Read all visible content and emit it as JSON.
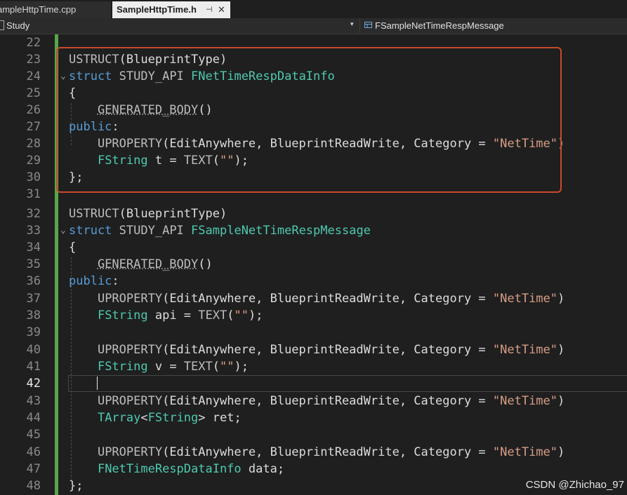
{
  "tabs": {
    "inactive_label": "ampleHttpTime.cpp",
    "active_label": "SampleHttpTime.h",
    "pin_glyph": "⊣",
    "close_glyph": "✕"
  },
  "navbar": {
    "scope_label": "Study",
    "member_label": "FSampleNetTimeRespMessage",
    "dropdown_glyph": "▾"
  },
  "editor": {
    "current_line": 42,
    "line_numbers": [
      "22",
      "23",
      "24",
      "25",
      "26",
      "27",
      "28",
      "29",
      "30",
      "31",
      "32",
      "33",
      "34",
      "35",
      "36",
      "37",
      "38",
      "39",
      "40",
      "41",
      "42",
      "43",
      "44",
      "45",
      "46",
      "47",
      "48"
    ],
    "fold_glyph": "⌄",
    "tokens": {
      "ustruct": "USTRUCT",
      "blueprint_type_args": "(BlueprintType)",
      "struct_kw": "struct",
      "study_api": "STUDY_API",
      "name1": "FNetTimeRespDataInfo",
      "name2": "FSampleNetTimeRespMessage",
      "open_brace": "{",
      "close_brace": "};",
      "generated_body": "GENERATED_BODY",
      "generated_body_parens": "()",
      "public_kw": "public",
      "colon": ":",
      "uproperty": "UPROPERTY",
      "uproperty_args_pre": "(EditAnywhere, BlueprintReadWrite, Category = ",
      "category_string": "\"NetTime\"",
      "close_paren": ")",
      "fstring": "FString",
      "var_t": " t = ",
      "var_api": " api = ",
      "var_v": " v = ",
      "text_macro": "TEXT",
      "open_paren": "(",
      "empty_string": "\"\"",
      "close_paren_semi": ");",
      "tarray": "TArray",
      "tarray_open": "<",
      "tarray_close": ">",
      "var_ret": " ret;",
      "data_type": "FNetTimeRespDataInfo",
      "var_data": " data;"
    }
  },
  "watermark": "CSDN @Zhichao_97",
  "colors": {
    "keyword": "#569cd6",
    "type": "#4ec9b0",
    "string": "#d69d85",
    "macro": "#bdbdbd",
    "change_bar": "#57a64a",
    "highlight_box": "#c84a2c"
  }
}
